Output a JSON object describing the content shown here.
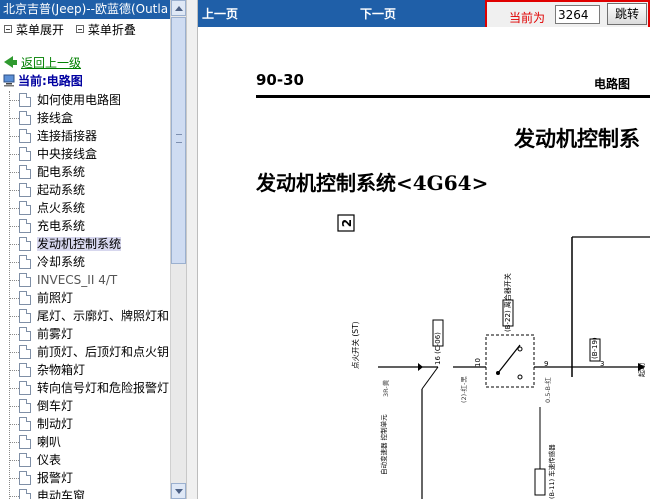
{
  "left": {
    "title": "北京吉普(Jeep)--欧蓝德(Outla",
    "menu_expand": "菜单展开",
    "menu_collapse": "菜单折叠",
    "back_label": "返回上一级",
    "current_label": "当前:电路图",
    "items": [
      {
        "label": "如何使用电路图"
      },
      {
        "label": "接线盒"
      },
      {
        "label": "连接插接器"
      },
      {
        "label": "中央接线盒"
      },
      {
        "label": "配电系统"
      },
      {
        "label": "起动系统"
      },
      {
        "label": "点火系统"
      },
      {
        "label": "充电系统"
      },
      {
        "label": "发动机控制系统"
      },
      {
        "label": "冷却系统"
      },
      {
        "label": "INVECS_II 4/T"
      },
      {
        "label": "前照灯"
      },
      {
        "label": "尾灯、示廓灯、牌照灯和"
      },
      {
        "label": "前雾灯"
      },
      {
        "label": "前顶灯、后顶灯和点火钥"
      },
      {
        "label": "杂物箱灯"
      },
      {
        "label": "转向信号灯和危险报警灯"
      },
      {
        "label": "倒车灯"
      },
      {
        "label": "制动灯"
      },
      {
        "label": "喇叭"
      },
      {
        "label": "仪表"
      },
      {
        "label": "报警灯"
      },
      {
        "label": "电动车窗"
      }
    ],
    "selected_index": 8
  },
  "toolbar": {
    "prev_label": "上一页",
    "next_label": "下一页",
    "goto_label": "当前为",
    "page_value": "3264",
    "goto_button": "跳转"
  },
  "document": {
    "page_number": "90-30",
    "section": "电路图",
    "big_title": "发动机控制系",
    "sub_title": "发动机控制系统<4G64>",
    "diagram": {
      "badge": "2",
      "label_st": "点火开关 (ST)",
      "label_c06": "16 (C-06)",
      "label_n10": "10",
      "label_b22": "(B-22) 离合器开关",
      "label_b19": "(B-19)",
      "label_n9": "9",
      "label_n3": "3",
      "label_start": "起动",
      "wire1": "3R-黄",
      "wire2": "(2)-红-黑",
      "wire3": "0.5-B-红",
      "label_auto": "自动变速器 控制单元",
      "label_b11": "(B-11) 车速传感器"
    }
  }
}
